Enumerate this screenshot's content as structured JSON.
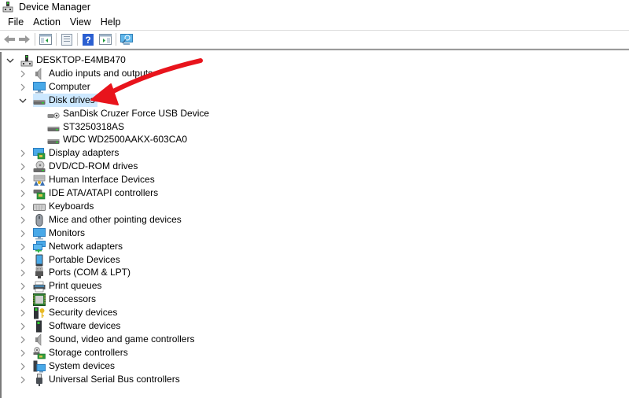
{
  "window": {
    "title": "Device Manager",
    "app_icon": "device-manager-icon"
  },
  "menubar": {
    "items": [
      "File",
      "Action",
      "View",
      "Help"
    ]
  },
  "toolbar": {
    "buttons": [
      {
        "name": "back-button",
        "icon": "arrow-left-icon"
      },
      {
        "name": "forward-button",
        "icon": "arrow-right-icon"
      },
      {
        "name": "show-hide-console-tree-button",
        "icon": "console-tree-icon"
      },
      {
        "name": "properties-button",
        "icon": "properties-icon"
      },
      {
        "name": "help-button",
        "icon": "help-icon"
      },
      {
        "name": "show-hide-action-pane-button",
        "icon": "action-pane-icon"
      },
      {
        "name": "scan-hardware-button",
        "icon": "monitor-scan-icon"
      }
    ]
  },
  "tree": {
    "root": {
      "label": "DESKTOP-E4MB470",
      "expanded": true,
      "icon": "computer-tower-icon"
    },
    "categories": [
      {
        "label": "Audio inputs and outputs",
        "icon": "speaker-icon",
        "expanded": false
      },
      {
        "label": "Computer",
        "icon": "monitor-icon",
        "expanded": false
      },
      {
        "label": "Disk drives",
        "icon": "disk-drive-icon",
        "expanded": true,
        "selected": true,
        "children": [
          {
            "label": "SanDisk Cruzer Force USB Device",
            "icon": "usb-drive-icon"
          },
          {
            "label": "ST3250318AS",
            "icon": "disk-drive-icon"
          },
          {
            "label": "WDC WD2500AAKX-603CA0",
            "icon": "disk-drive-icon"
          }
        ]
      },
      {
        "label": "Display adapters",
        "icon": "display-adapter-icon",
        "expanded": false
      },
      {
        "label": "DVD/CD-ROM drives",
        "icon": "dvd-drive-icon",
        "expanded": false
      },
      {
        "label": "Human Interface Devices",
        "icon": "hid-icon",
        "expanded": false
      },
      {
        "label": "IDE ATA/ATAPI controllers",
        "icon": "ide-controller-icon",
        "expanded": false
      },
      {
        "label": "Keyboards",
        "icon": "keyboard-icon",
        "expanded": false
      },
      {
        "label": "Mice and other pointing devices",
        "icon": "mouse-icon",
        "expanded": false
      },
      {
        "label": "Monitors",
        "icon": "monitor-icon",
        "expanded": false
      },
      {
        "label": "Network adapters",
        "icon": "network-icon",
        "expanded": false
      },
      {
        "label": "Portable Devices",
        "icon": "portable-device-icon",
        "expanded": false
      },
      {
        "label": "Ports (COM & LPT)",
        "icon": "port-icon",
        "expanded": false
      },
      {
        "label": "Print queues",
        "icon": "printer-icon",
        "expanded": false
      },
      {
        "label": "Processors",
        "icon": "processor-icon",
        "expanded": false
      },
      {
        "label": "Security devices",
        "icon": "security-key-icon",
        "expanded": false
      },
      {
        "label": "Software devices",
        "icon": "software-device-icon",
        "expanded": false
      },
      {
        "label": "Sound, video and game controllers",
        "icon": "speaker-icon",
        "expanded": false
      },
      {
        "label": "Storage controllers",
        "icon": "storage-controller-icon",
        "expanded": false
      },
      {
        "label": "System devices",
        "icon": "system-devices-icon",
        "expanded": false
      },
      {
        "label": "Universal Serial Bus controllers",
        "icon": "usb-plug-icon",
        "expanded": false
      }
    ]
  },
  "annotation": {
    "type": "arrow",
    "color": "#e8141c",
    "points_to": "Disk drives"
  },
  "colors": {
    "selection": "#cce8ff"
  }
}
